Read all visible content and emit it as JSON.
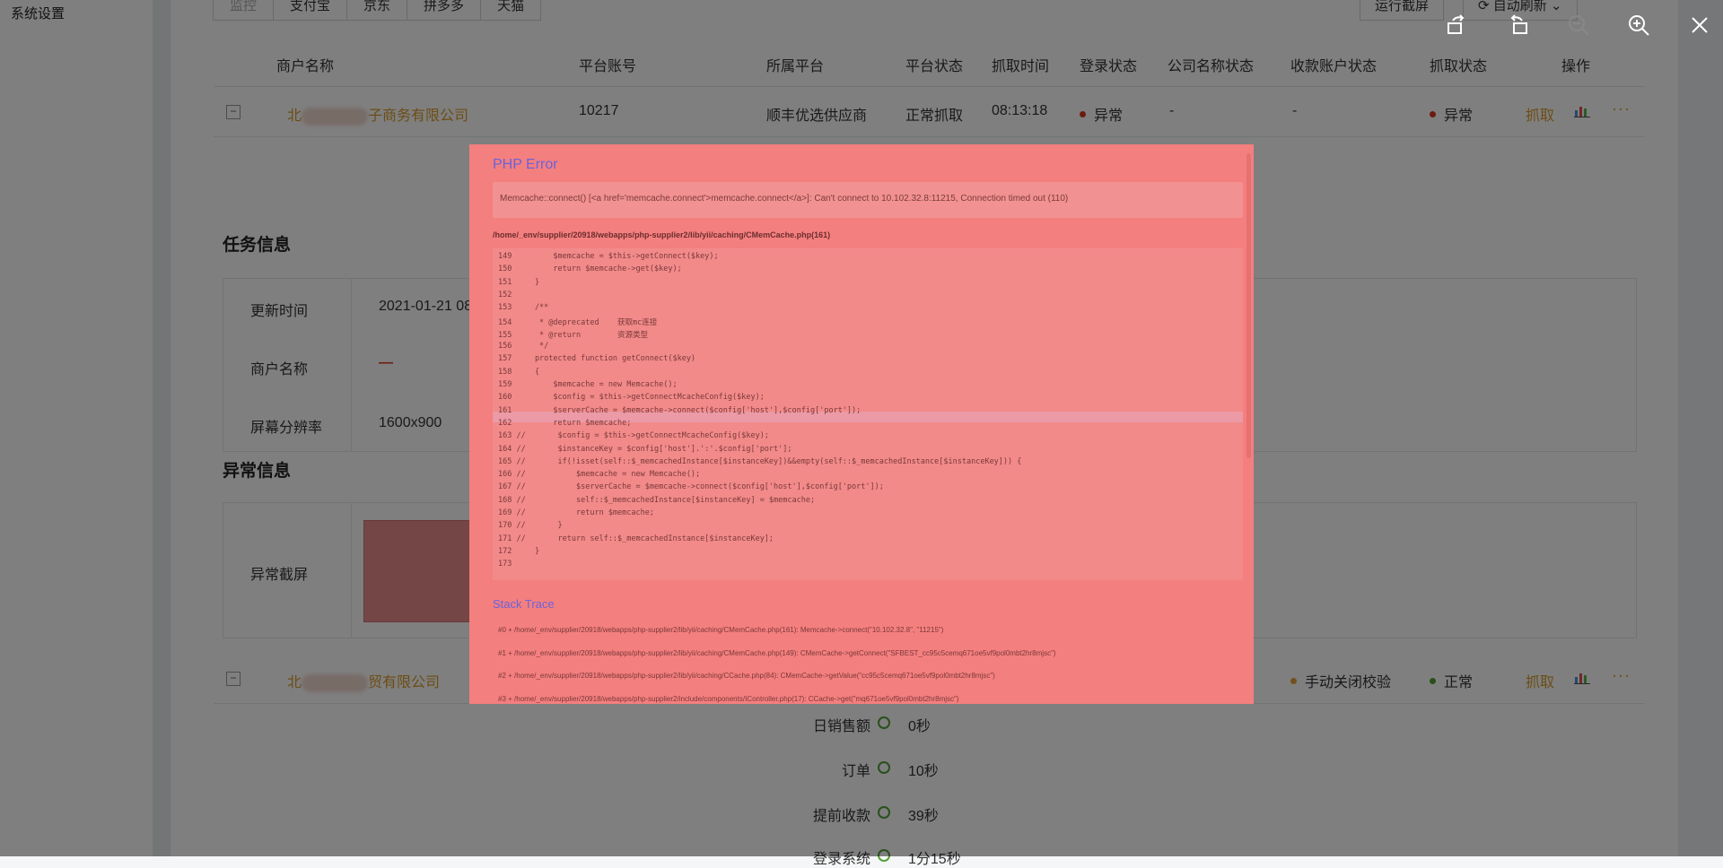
{
  "sidebar": {
    "title": "系统设置"
  },
  "platform_tabs": [
    "监控",
    "支付宝",
    "京东",
    "拼多多",
    "天猫"
  ],
  "top_buttons": {
    "screenshot": "运行截屏",
    "auto_refresh": "自动刷新"
  },
  "table": {
    "headers": [
      "商户名称",
      "平台账号",
      "所属平台",
      "平台状态",
      "抓取时间",
      "登录状态",
      "公司名称状态",
      "收款账户状态",
      "抓取状态",
      "操作"
    ],
    "rows": [
      {
        "toggle": "−",
        "merchant_prefix": "北",
        "merchant_suffix": "子商务有限公司",
        "account": "10217",
        "platform": "顺丰优选供应商",
        "platform_status": "正常抓取",
        "fetch_time": "08:13:18",
        "login_status": "异常",
        "company_status": "-",
        "payee_status": "-",
        "fetch_status": "异常",
        "op_fetch": "抓取",
        "op_more": "···"
      },
      {
        "toggle": "−",
        "merchant_prefix": "北",
        "merchant_suffix": "贸有限公司",
        "payee_status": "手动关闭校验",
        "fetch_status": "正常",
        "op_fetch": "抓取",
        "op_more": "···"
      }
    ]
  },
  "task_info": {
    "title": "任务信息",
    "update_time_label": "更新时间",
    "update_time_value": "2021-01-21 08",
    "merchant_label": "商户名称",
    "merchant_value": "—",
    "resolution_label": "屏幕分辨率",
    "resolution_value": "1600x900"
  },
  "error_info": {
    "title": "异常信息",
    "screenshot_label": "异常截屏"
  },
  "timeline": [
    {
      "label": "日销售额",
      "value": "0秒"
    },
    {
      "label": "订单",
      "value": "10秒"
    },
    {
      "label": "提前收款",
      "value": "39秒"
    },
    {
      "label": "登录系统",
      "value": "1分15秒"
    }
  ],
  "viewer": {
    "toolbar_icons": [
      "rotate-left-icon",
      "rotate-right-icon",
      "zoom-out-icon",
      "zoom-in-icon",
      "close-icon"
    ],
    "preview": {
      "title": "PHP Error",
      "message": "Memcache::connect() [<a href='memcache.connect'>memcache.connect</a>]: Can't connect to 10.102.32.8:11215, Connection timed out (110)",
      "path": "/home/_env/supplier/20918/webapps/php-supplier2/lib/yii/caching/CMemCache.php(161)",
      "code_lines": [
        "149         $memcache = $this->getConnect($key);",
        "150         return $memcache->get($key);",
        "151     }",
        "152",
        "153     /**",
        "154      * @deprecated    获取mc连接",
        "155      * @return        资源类型",
        "156      */",
        "157     protected function getConnect($key)",
        "158     {",
        "159         $memcache = new Memcache();",
        "160         $config = $this->getConnectMcacheConfig($key);",
        "161         $serverCache = $memcache->connect($config['host'],$config['port']);",
        "162         return $memcache;",
        "163 //       $config = $this->getConnectMcacheConfig($key);",
        "164 //       $instanceKey = $config['host'].':'.$config['port'];",
        "165 //       if(!isset(self::$_memcachedInstance[$instanceKey])&&empty(self::$_memcachedInstance[$instanceKey])) {",
        "166 //           $memcache = new Memcache();",
        "167 //           $serverCache = $memcache->connect($config['host'],$config['port']);",
        "168 //           self::$_memcachedInstance[$instanceKey] = $memcache;",
        "169 //           return $memcache;",
        "170 //       }",
        "171 //       return self::$_memcachedInstance[$instanceKey];",
        "172     }",
        "173"
      ],
      "stack_title": "Stack Trace",
      "stack_lines": [
        "#0  + /home/_env/supplier/20918/webapps/php-supplier2/lib/yii/caching/CMemCache.php(161): Memcache->connect(\"10.102.32.8\", \"11215\")",
        "#1  + /home/_env/supplier/20918/webapps/php-supplier2/lib/yii/caching/CMemCache.php(149): CMemCache->getConnect(\"SFBEST_cc95c5cemq671oe5vf9pol0mbt2hr8mjsc\")",
        "#2  + /home/_env/supplier/20918/webapps/php-supplier2/lib/yii/caching/CCache.php(84): CMemCache->getValue(\"cc95c5cemq671oe5vf9pol0mbt2hr8mjsc\")",
        "#3  + /home/_env/supplier/20918/webapps/php-supplier2/include/components/IController.php(17): CCache->get(\"mq671oe5vf9pol0mbt2hr8mjsc\")"
      ]
    }
  },
  "colors": {
    "accent": "#d99a2b",
    "error_dot": "#d9381e",
    "ok_dot": "#52a036",
    "warn_dot": "#e6a23c"
  }
}
